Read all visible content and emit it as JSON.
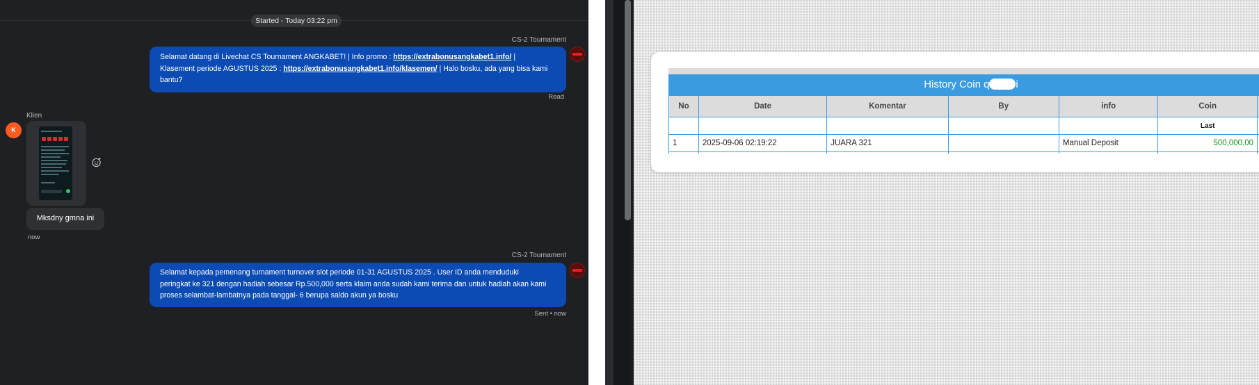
{
  "chat": {
    "started": "Started - Today 03:22 pm",
    "messages": [
      {
        "sender": "CS-2 Tournament",
        "text_a": "Selamat datang di Livechat CS Tournament ANGKABET! | Info promo : ",
        "link_a": "https://extrabonusangkabet1.info/",
        "text_b": " |",
        "text_c": "Klasement periode AGUSTUS 2025 : ",
        "link_b": "https://extrabonusangkabet1.info/klasemen/",
        "text_d": " | Halo bosku, ada yang bisa kami",
        "text_e": "bantu?",
        "status": "Read"
      },
      {
        "sender": "CS-2 Tournament",
        "line1": "Selamat kepada pemenang turnament turnover slot periode 01-31 AGUSTUS 2025 . User ID anda menduduki",
        "line2": "peringkat ke 321 dengan hadiah sebesar Rp.500,000 serta klaim anda sudah kami terima dan untuk hadiah akan kami",
        "line3": "proses selambat-lambatnya pada tanggal- 6 berupa saldo akun ya bosku",
        "status": "Sent • now"
      }
    ],
    "client": {
      "name": "Klien",
      "avatar_letter": "K",
      "message": "Mksdny gmna ini",
      "time": "now"
    }
  },
  "history": {
    "title_prefix": "History Coin q",
    "title_suffix": "i",
    "columns": [
      "No",
      "Date",
      "Komentar",
      "By",
      "info",
      "Coin"
    ],
    "subheader": "Last",
    "rows": [
      {
        "no": "1",
        "date": "2025-09-06 02:19:22",
        "komentar": "JUARA 321",
        "by": "",
        "info": "Manual Deposit",
        "coin": "500,000.00"
      }
    ]
  },
  "colors": {
    "bubble": "#0b4bb3",
    "table_header": "#3b9be0",
    "coin_green": "#1a8f1a",
    "client_avatar": "#ff5a1f"
  }
}
